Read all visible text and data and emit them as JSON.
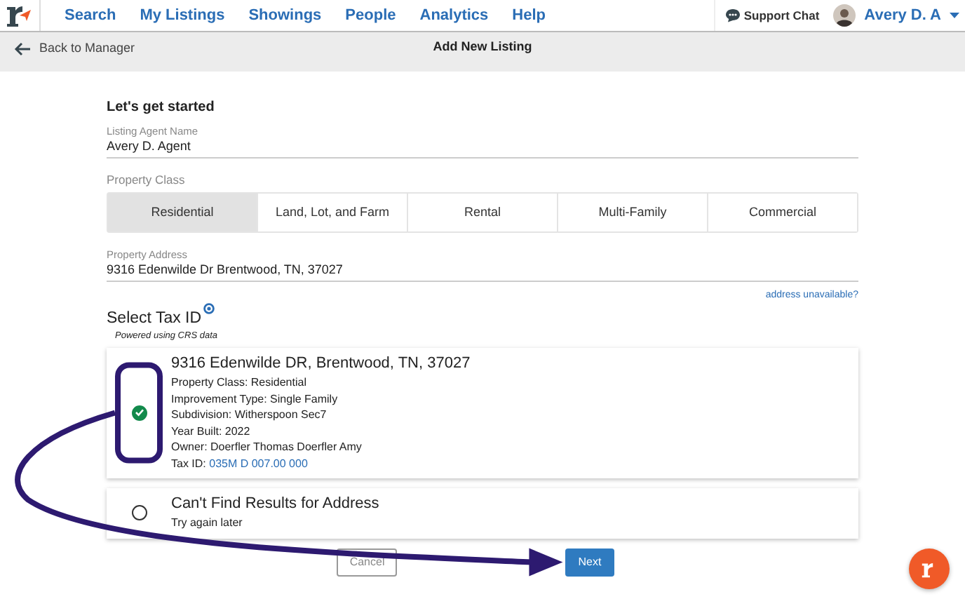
{
  "nav": {
    "items": [
      {
        "label": "Search"
      },
      {
        "label": "My Listings"
      },
      {
        "label": "Showings"
      },
      {
        "label": "People"
      },
      {
        "label": "Analytics"
      },
      {
        "label": "Help"
      }
    ],
    "support": "Support Chat",
    "user": "Avery D. A"
  },
  "header": {
    "back": "Back to Manager",
    "title": "Add New Listing"
  },
  "form": {
    "heading": "Let's get started",
    "agent": {
      "label": "Listing Agent Name",
      "value": "Avery D. Agent"
    },
    "class_label": "Property Class",
    "classes": [
      {
        "label": "Residential",
        "selected": true
      },
      {
        "label": "Land, Lot, and Farm",
        "selected": false
      },
      {
        "label": "Rental",
        "selected": false
      },
      {
        "label": "Multi-Family",
        "selected": false
      },
      {
        "label": "Commercial",
        "selected": false
      }
    ],
    "address": {
      "label": "Property Address",
      "value": "9316 Edenwilde Dr Brentwood, TN, 37027"
    },
    "address_link": "address unavailable?",
    "tax_heading": "Select Tax ID",
    "tax_note": "Powered using CRS data",
    "results": [
      {
        "title": "9316 Edenwilde DR, Brentwood, TN, 37027",
        "selected": true,
        "lines": [
          "Property Class: Residential",
          "Improvement Type: Single Family",
          "Subdivision: Witherspoon Sec7",
          "Year Built: 2022",
          "Owner: Doerfler Thomas Doerfler Amy"
        ],
        "tax_label": "Tax ID:",
        "tax_id": "035M D 007.00 000"
      },
      {
        "title": "Can't Find Results for Address",
        "selected": false,
        "lines": [
          "Try again later"
        ]
      }
    ],
    "buttons": [
      {
        "label": "Cancel",
        "kind": "secondary"
      },
      {
        "label": "Next",
        "kind": "primary"
      }
    ]
  }
}
